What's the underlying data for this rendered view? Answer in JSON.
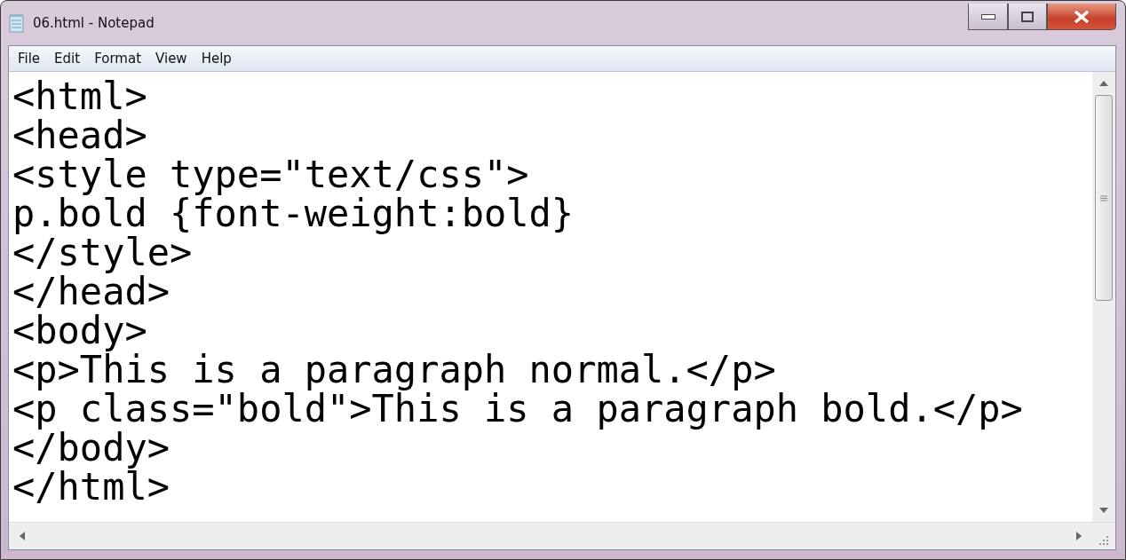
{
  "window": {
    "title": "06.html - Notepad"
  },
  "menu": [
    {
      "label": "File"
    },
    {
      "label": "Edit"
    },
    {
      "label": "Format"
    },
    {
      "label": "View"
    },
    {
      "label": "Help"
    }
  ],
  "editor": {
    "lines": [
      "<html>",
      "<head>",
      "<style type=\"text/css\">",
      "p.bold {font-weight:bold}",
      "</style>",
      "</head>",
      "<body>",
      "<p>This is a paragraph normal.</p>",
      "<p class=\"bold\">This is a paragraph bold.</p>",
      "</body>",
      "</html>"
    ]
  }
}
